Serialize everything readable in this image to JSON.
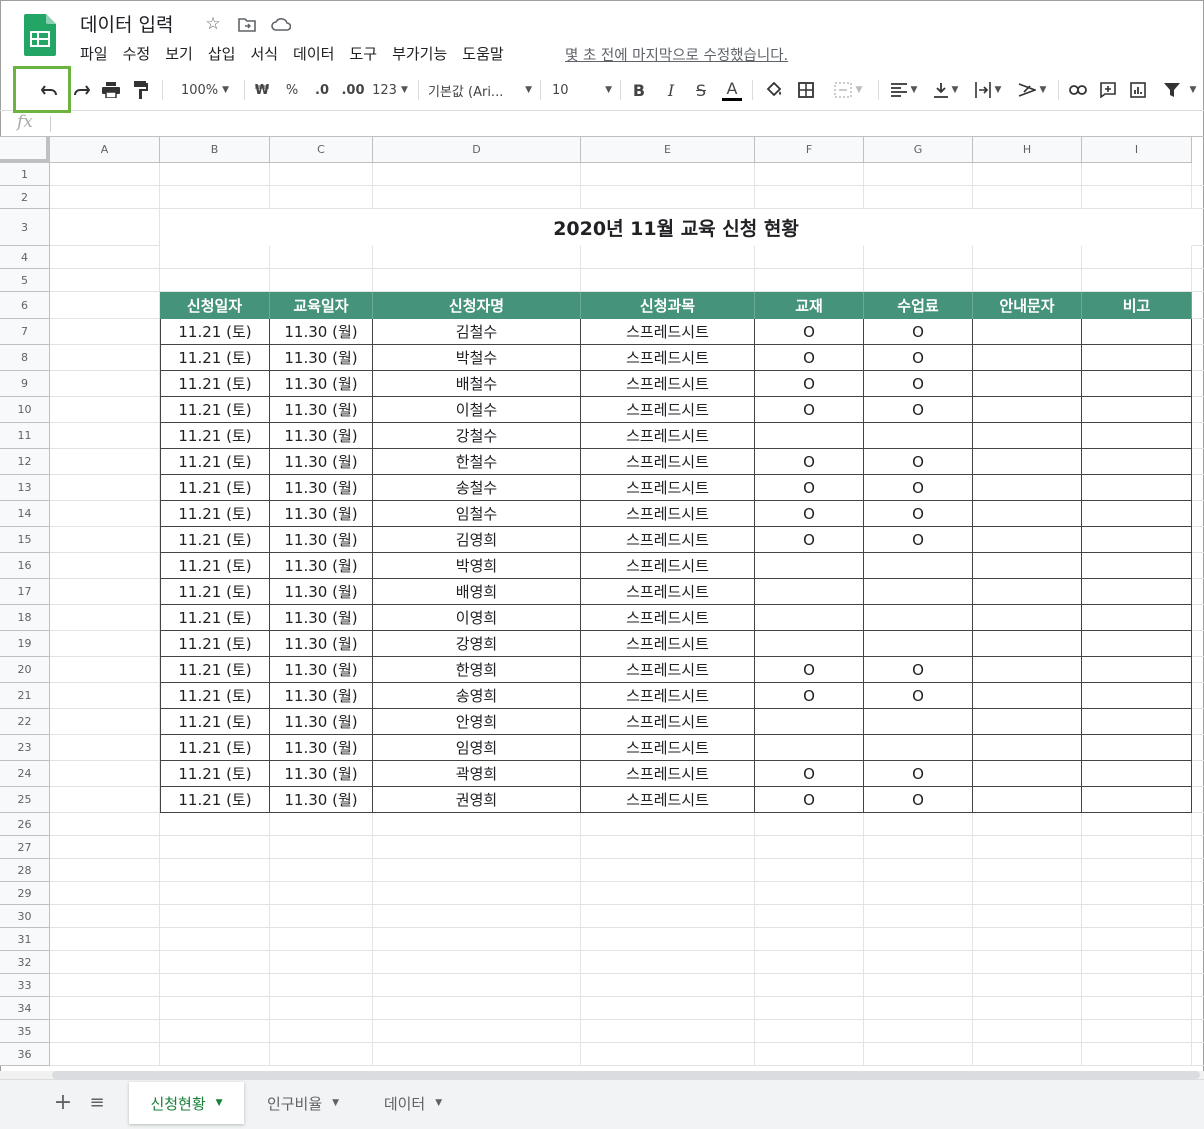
{
  "app": {
    "doc_title": "데이터 입력",
    "last_edit": "몇 초 전에 마지막으로 수정했습니다."
  },
  "menu": [
    "파일",
    "수정",
    "보기",
    "삽입",
    "서식",
    "데이터",
    "도구",
    "부가기능",
    "도움말"
  ],
  "toolbar": {
    "zoom": "100%",
    "currency": "₩",
    "percent": "%",
    "dec_decrease": ".0",
    "dec_increase": ".00",
    "number_format": "123",
    "font": "기본값 (Ari...",
    "font_size": "10",
    "bold": "B",
    "italic": "I",
    "strike": "S",
    "text_color": "A",
    "accent_color": "#45937a"
  },
  "formula_bar": {
    "icon": "fx",
    "value": ""
  },
  "columns": [
    "A",
    "B",
    "C",
    "D",
    "E",
    "F",
    "G",
    "H",
    "I"
  ],
  "rows": [
    "1",
    "2",
    "3",
    "4",
    "5",
    "6",
    "7",
    "8",
    "9",
    "10",
    "11",
    "12",
    "13",
    "14",
    "15",
    "16",
    "17",
    "18",
    "19",
    "20",
    "21",
    "22",
    "23",
    "24",
    "25",
    "26",
    "27",
    "28",
    "29",
    "30",
    "31",
    "32",
    "33",
    "34",
    "35",
    "36"
  ],
  "sheet": {
    "title": "2020년 11월 교육 신청 현황",
    "headers": [
      "신청일자",
      "교육일자",
      "신청자명",
      "신청과목",
      "교재",
      "수업료",
      "안내문자",
      "비고"
    ],
    "rows": [
      [
        "11.21 (토)",
        "11.30 (월)",
        "김철수",
        "스프레드시트",
        "O",
        "O",
        "",
        ""
      ],
      [
        "11.21 (토)",
        "11.30 (월)",
        "박철수",
        "스프레드시트",
        "O",
        "O",
        "",
        ""
      ],
      [
        "11.21 (토)",
        "11.30 (월)",
        "배철수",
        "스프레드시트",
        "O",
        "O",
        "",
        ""
      ],
      [
        "11.21 (토)",
        "11.30 (월)",
        "이철수",
        "스프레드시트",
        "O",
        "O",
        "",
        ""
      ],
      [
        "11.21 (토)",
        "11.30 (월)",
        "강철수",
        "스프레드시트",
        "",
        "",
        "",
        ""
      ],
      [
        "11.21 (토)",
        "11.30 (월)",
        "한철수",
        "스프레드시트",
        "O",
        "O",
        "",
        ""
      ],
      [
        "11.21 (토)",
        "11.30 (월)",
        "송철수",
        "스프레드시트",
        "O",
        "O",
        "",
        ""
      ],
      [
        "11.21 (토)",
        "11.30 (월)",
        "임철수",
        "스프레드시트",
        "O",
        "O",
        "",
        ""
      ],
      [
        "11.21 (토)",
        "11.30 (월)",
        "김영희",
        "스프레드시트",
        "O",
        "O",
        "",
        ""
      ],
      [
        "11.21 (토)",
        "11.30 (월)",
        "박영희",
        "스프레드시트",
        "",
        "",
        "",
        ""
      ],
      [
        "11.21 (토)",
        "11.30 (월)",
        "배영희",
        "스프레드시트",
        "",
        "",
        "",
        ""
      ],
      [
        "11.21 (토)",
        "11.30 (월)",
        "이영희",
        "스프레드시트",
        "",
        "",
        "",
        ""
      ],
      [
        "11.21 (토)",
        "11.30 (월)",
        "강영희",
        "스프레드시트",
        "",
        "",
        "",
        ""
      ],
      [
        "11.21 (토)",
        "11.30 (월)",
        "한영희",
        "스프레드시트",
        "O",
        "O",
        "",
        ""
      ],
      [
        "11.21 (토)",
        "11.30 (월)",
        "송영희",
        "스프레드시트",
        "O",
        "O",
        "",
        ""
      ],
      [
        "11.21 (토)",
        "11.30 (월)",
        "안영희",
        "스프레드시트",
        "",
        "",
        "",
        ""
      ],
      [
        "11.21 (토)",
        "11.30 (월)",
        "임영희",
        "스프레드시트",
        "",
        "",
        "",
        ""
      ],
      [
        "11.21 (토)",
        "11.30 (월)",
        "곽영희",
        "스프레드시트",
        "O",
        "O",
        "",
        ""
      ],
      [
        "11.21 (토)",
        "11.30 (월)",
        "권영희",
        "스프레드시트",
        "O",
        "O",
        "",
        ""
      ]
    ]
  },
  "sheet_tabs": [
    {
      "label": "신청현황",
      "active": true
    },
    {
      "label": "인구비율",
      "active": false
    },
    {
      "label": "데이터",
      "active": false
    }
  ]
}
